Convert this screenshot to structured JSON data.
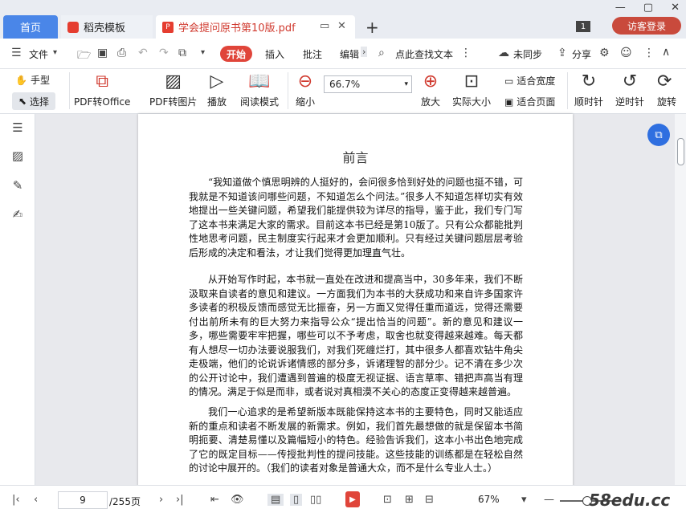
{
  "tabs": {
    "home": "首页",
    "template": "稻壳模板",
    "pdf_file": "学会提问原书第10版.pdf",
    "pdf_icon_text": "P",
    "new_tab": "+"
  },
  "window": {
    "count_badge": "1",
    "login": "访客登录",
    "minimize": "—",
    "maximize": "▢",
    "close": "✕"
  },
  "menu": {
    "file": "文件",
    "start": "开始",
    "insert": "插入",
    "annotate": "批注",
    "edit": "编辑",
    "search": "点此查找文本",
    "sync": "未同步",
    "share": "分享"
  },
  "ribbon": {
    "hand": "手型",
    "select": "选择",
    "pdf_to_office": "PDF转Office",
    "pdf_to_image": "PDF转图片",
    "play": "播放",
    "read_mode": "阅读模式",
    "zoom_out": "缩小",
    "zoom_value": "66.7%",
    "zoom_in": "放大",
    "actual_size": "实际大小",
    "fit_width": "适合宽度",
    "fit_page": "适合页面",
    "rotate_cw": "顺时针",
    "rotate_ccw": "逆时针",
    "rotate_page": "旋转"
  },
  "document": {
    "title": "前言",
    "paragraphs": [
      "“我知道做个慎思明辨的人挺好的，会问很多恰到好处的问题也挺不错，可我就是不知道该问哪些问题，不知道怎么个问法。”很多人不知道怎样切实有效地提出一些关键问题，希望我们能提供较为详尽的指导，鉴于此，我们专门写了这本书来满足大家的需求。目前这本书已经是第10版了。只有公众都能批判性地思考问题，民主制度实行起来才会更加顺利。只有经过关键问题层层考验后形成的决定和看法，才让我们觉得更加理直气壮。",
      "从开始写作时起，本书就一直处在改进和提高当中，30多年来，我们不断汲取来自读者的意见和建议。一方面我们为本书的大获成功和来自许多国家许多读者的积极反馈而感觉无比振奋，另一方面又觉得任重而道远，觉得还需要付出前所未有的巨大努力来指导公众“提出恰当的问题”。新的意见和建议一多，哪些需要牢牢把握，哪些可以不予考虑，取舍也就变得越来越难。每天都有人想尽一切办法要说服我们，对我们死缠烂打，其中很多人都喜欢钻牛角尖走极端，他们的论说诉诸情感的部分多，诉诸理智的部分少。记不清在多少次的公开讨论中，我们遭遇到普遍的极度无视证据、语言草率、错把声高当有理的情况。满足于似是而非，或者说对真相漠不关心的态度正变得越来越普遍。",
      "我们一心追求的是希望新版本既能保持这本书的主要特色，同时又能适应新的重点和读者不断发展的新需求。例如，我们首先最想做的就是保留本书简明扼要、清楚易懂以及篇幅短小的特色。经验告诉我们，这本小书出色地完成了它的既定目标——传授批判性的提问技能。这些技能的训练都是在轻松自然的讨论中展开的。（我们的读者对象是普通大众，而不是什么专业人士。）"
    ]
  },
  "status": {
    "current_page": "9",
    "total_pages": "/255页",
    "zoom": "67%",
    "watermark": "58edu.cc"
  },
  "colors": {
    "accent_blue": "#4a86e8",
    "start_red": "#e0453a",
    "login_red": "#c94a3c"
  }
}
